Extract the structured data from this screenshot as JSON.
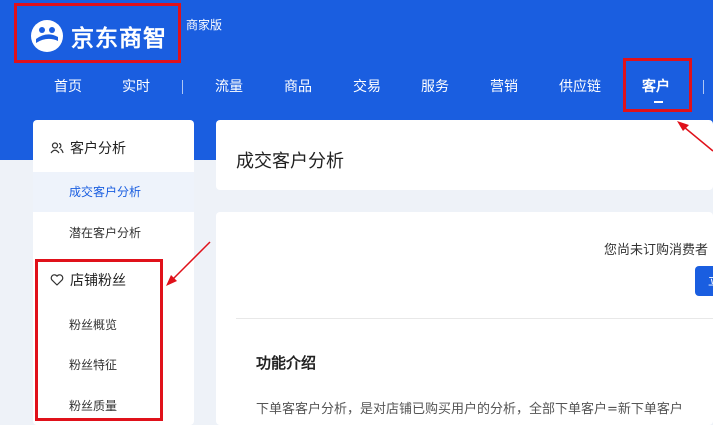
{
  "brand": {
    "name": "京东商智",
    "edition": "商家版"
  },
  "nav": {
    "items": [
      {
        "label": "首页"
      },
      {
        "label": "实时"
      },
      {
        "label": "流量"
      },
      {
        "label": "商品"
      },
      {
        "label": "交易"
      },
      {
        "label": "服务"
      },
      {
        "label": "营销"
      },
      {
        "label": "供应链"
      },
      {
        "label": "客户",
        "active": true
      }
    ]
  },
  "sidebar": {
    "groups": [
      {
        "label": "客户分析",
        "icon": "users-icon",
        "items": [
          {
            "label": "成交客户分析",
            "active": true
          },
          {
            "label": "潜在客户分析"
          }
        ]
      },
      {
        "label": "店铺粉丝",
        "icon": "heart-icon",
        "items": [
          {
            "label": "粉丝概览"
          },
          {
            "label": "粉丝特征"
          },
          {
            "label": "粉丝质量"
          }
        ]
      }
    ]
  },
  "main": {
    "page_title": "成交客户分析",
    "notice": "您尚未订购消费者",
    "cta_label": "立",
    "section_title": "功能介绍",
    "description": "下单客客户分析，是对店铺已购买用户的分析，全部下单客户=新下单客户"
  },
  "colors": {
    "brand_blue": "#1a5ee0",
    "annotation_red": "#e0111a"
  }
}
